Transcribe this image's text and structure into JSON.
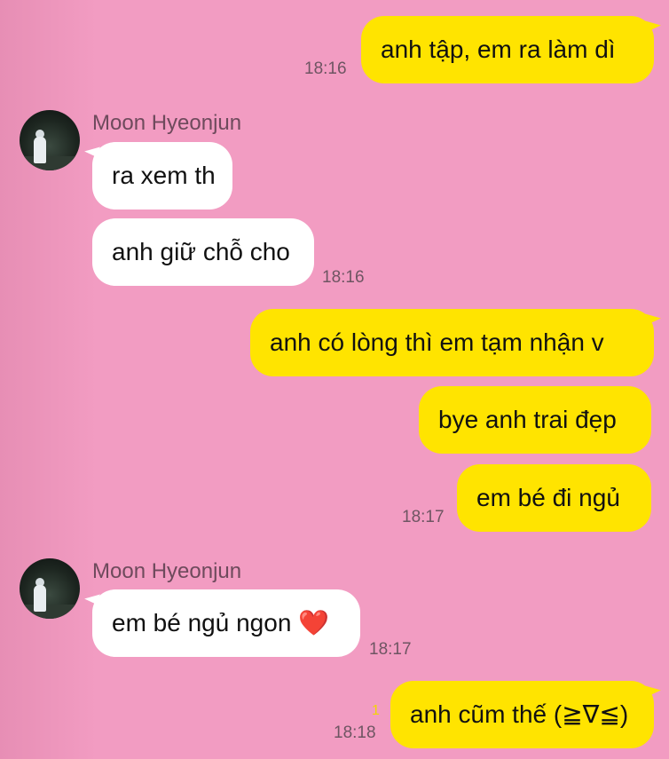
{
  "chat": {
    "messages": [
      {
        "text": "anh tập, em ra làm dì",
        "time": "18:16"
      },
      {
        "sender": "Moon Hyeonjun",
        "text": "ra xem th"
      },
      {
        "text": "anh giữ chỗ cho",
        "time": "18:16"
      },
      {
        "text": "anh có lòng thì em tạm nhận v"
      },
      {
        "text": "bye anh trai đẹp"
      },
      {
        "text": "em bé đi ngủ",
        "time": "18:17"
      },
      {
        "sender": "Moon Hyeonjun",
        "text": "em bé ngủ ngon ❤️",
        "time": "18:17"
      },
      {
        "text": "anh cũm thế (≧∇≦)",
        "time": "18:18",
        "unread": "1"
      }
    ]
  },
  "colors": {
    "background": "#f29cc2",
    "outgoing_bubble": "#ffe400",
    "incoming_bubble": "#ffffff"
  },
  "icons": {
    "avatar": "profile-photo"
  }
}
